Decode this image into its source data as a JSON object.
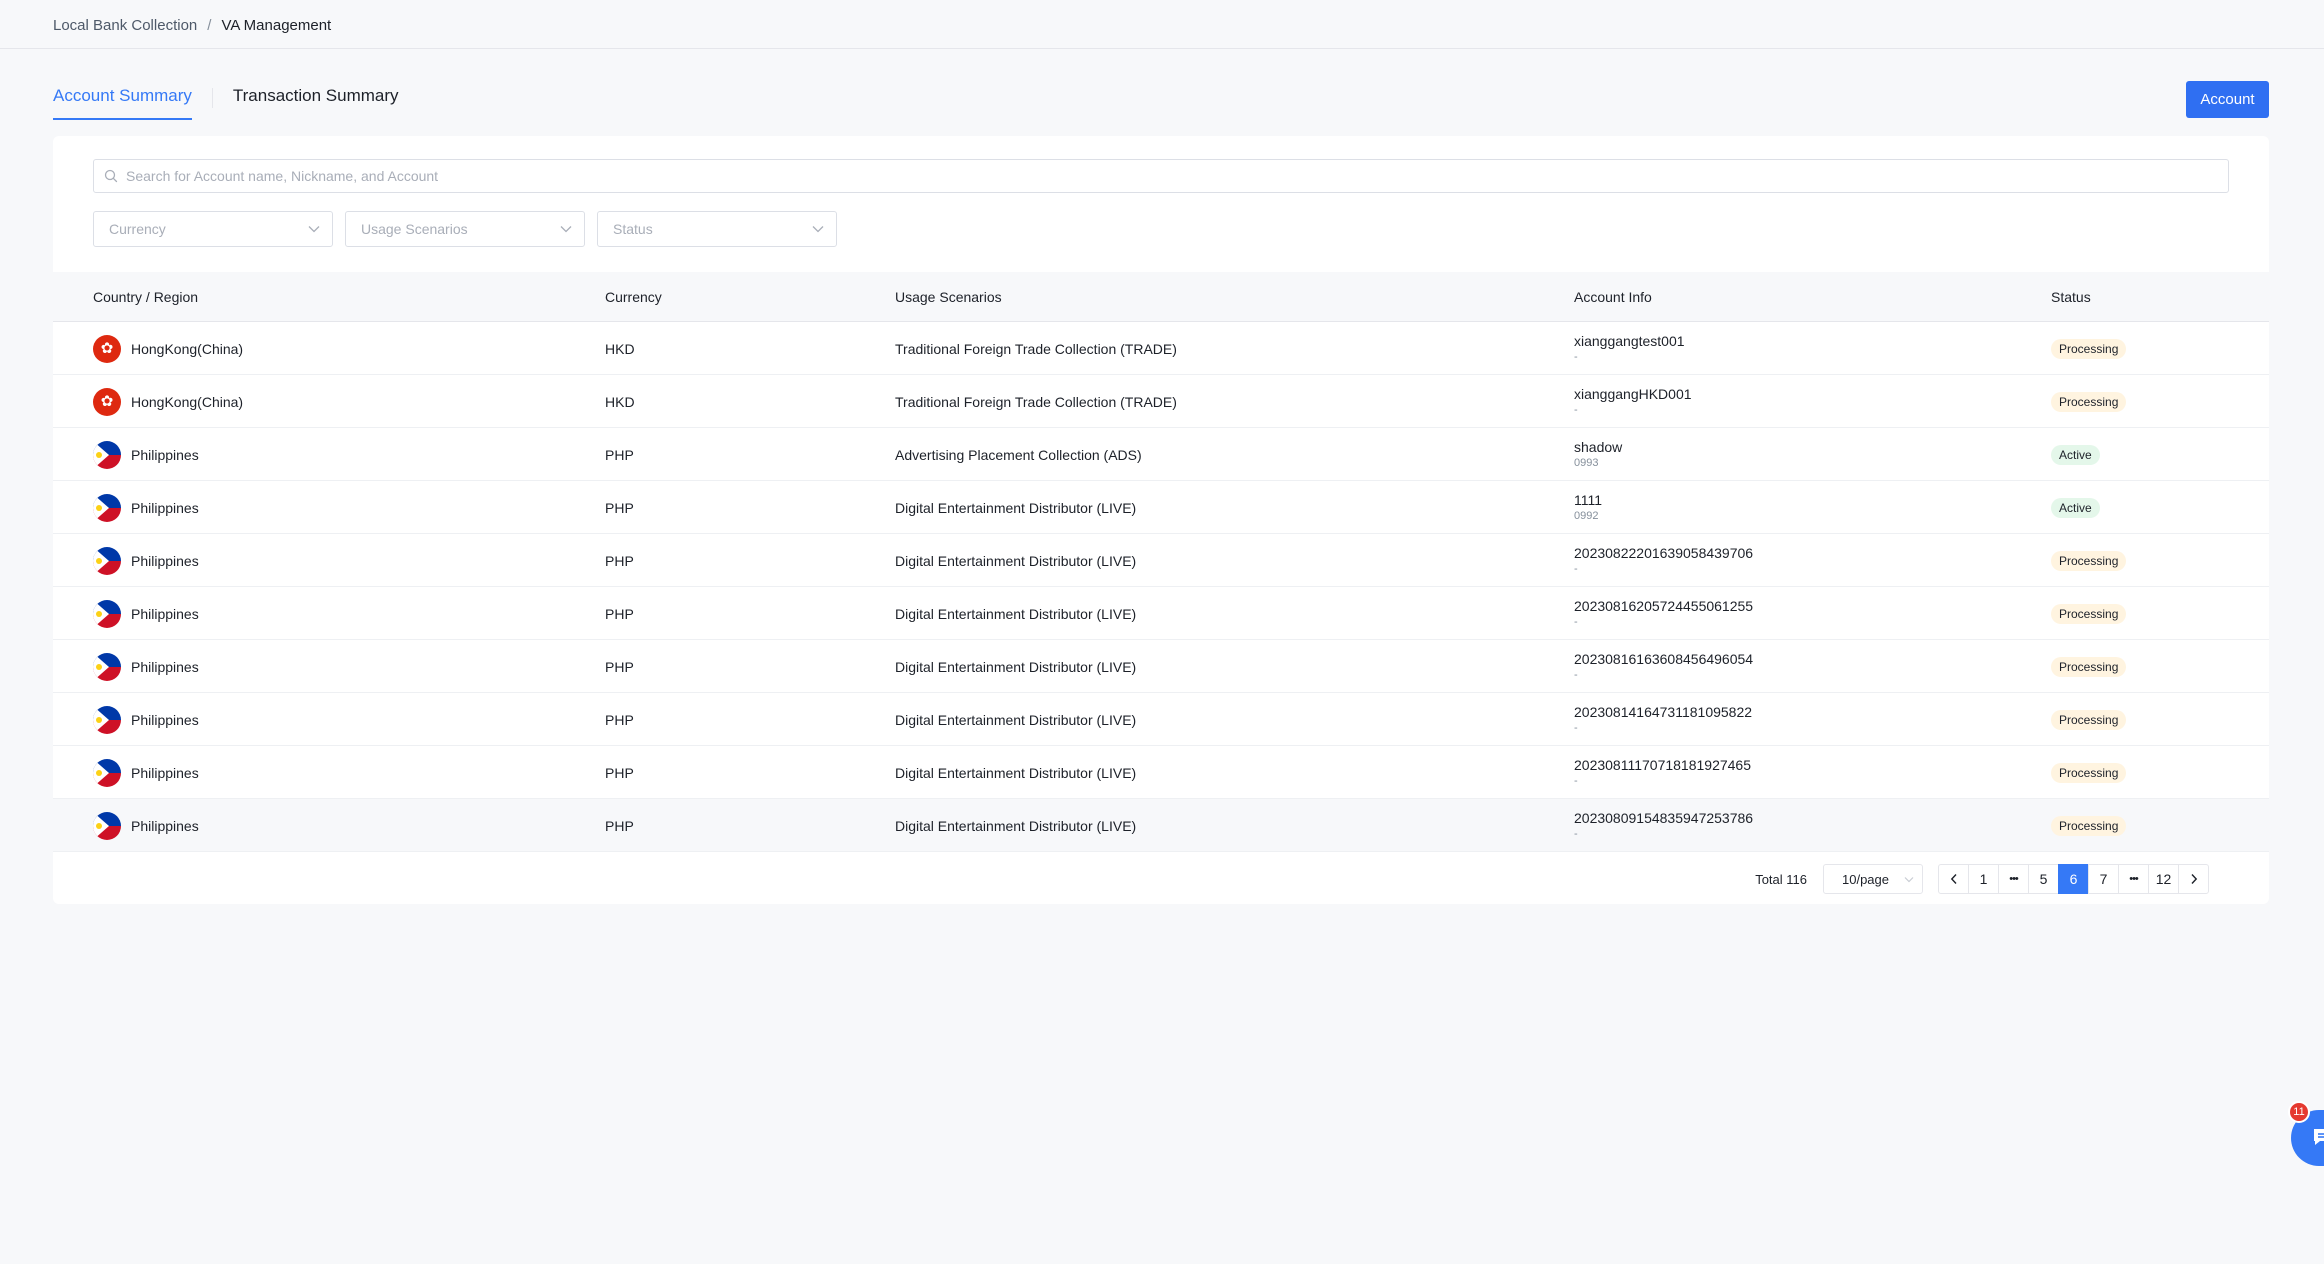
{
  "breadcrumb": {
    "items": [
      "Local Bank Collection",
      "VA Management"
    ],
    "separator": "/"
  },
  "tabs": [
    {
      "label": "Account Summary",
      "active": true
    },
    {
      "label": "Transaction Summary",
      "active": false
    }
  ],
  "account_button": {
    "label": "Account"
  },
  "search": {
    "placeholder": "Search for Account name, Nickname, and Account",
    "value": ""
  },
  "filters": {
    "currency": {
      "placeholder": "Currency"
    },
    "usage_scenarios": {
      "placeholder": "Usage Scenarios"
    },
    "status": {
      "placeholder": "Status"
    }
  },
  "table": {
    "columns": [
      "Country / Region",
      "Currency",
      "Usage Scenarios",
      "Account Info",
      "Status"
    ],
    "rows": [
      {
        "country": "HongKong(China)",
        "flag": "hk",
        "currency": "HKD",
        "usage": "Traditional Foreign Trade Collection (TRADE)",
        "account": "xianggangtest001",
        "account_sub": "-",
        "status": "Processing"
      },
      {
        "country": "HongKong(China)",
        "flag": "hk",
        "currency": "HKD",
        "usage": "Traditional Foreign Trade Collection (TRADE)",
        "account": "xianggangHKD001",
        "account_sub": "-",
        "status": "Processing"
      },
      {
        "country": "Philippines",
        "flag": "ph",
        "currency": "PHP",
        "usage": "Advertising Placement Collection (ADS)",
        "account": "shadow",
        "account_sub": "0993",
        "status": "Active"
      },
      {
        "country": "Philippines",
        "flag": "ph",
        "currency": "PHP",
        "usage": "Digital Entertainment Distributor (LIVE)",
        "account": "1111",
        "account_sub": "0992",
        "status": "Active"
      },
      {
        "country": "Philippines",
        "flag": "ph",
        "currency": "PHP",
        "usage": "Digital Entertainment Distributor (LIVE)",
        "account": "20230822201639058439706",
        "account_sub": "-",
        "status": "Processing"
      },
      {
        "country": "Philippines",
        "flag": "ph",
        "currency": "PHP",
        "usage": "Digital Entertainment Distributor (LIVE)",
        "account": "20230816205724455061255",
        "account_sub": "-",
        "status": "Processing"
      },
      {
        "country": "Philippines",
        "flag": "ph",
        "currency": "PHP",
        "usage": "Digital Entertainment Distributor (LIVE)",
        "account": "20230816163608456496054",
        "account_sub": "-",
        "status": "Processing"
      },
      {
        "country": "Philippines",
        "flag": "ph",
        "currency": "PHP",
        "usage": "Digital Entertainment Distributor (LIVE)",
        "account": "20230814164731181095822",
        "account_sub": "-",
        "status": "Processing"
      },
      {
        "country": "Philippines",
        "flag": "ph",
        "currency": "PHP",
        "usage": "Digital Entertainment Distributor (LIVE)",
        "account": "20230811170718181927465",
        "account_sub": "-",
        "status": "Processing"
      },
      {
        "country": "Philippines",
        "flag": "ph",
        "currency": "PHP",
        "usage": "Digital Entertainment Distributor (LIVE)",
        "account": "20230809154835947253786",
        "account_sub": "-",
        "status": "Processing"
      }
    ]
  },
  "pagination": {
    "total_label": "Total 116",
    "page_size": "10/page",
    "pages": [
      "1",
      "•••",
      "5",
      "6",
      "7",
      "•••",
      "12"
    ],
    "current": "6"
  },
  "chat": {
    "badge": "11"
  },
  "colors": {
    "accent": "#3579f6",
    "processing_bg": "#fff4e0",
    "active_bg": "#e4f7ea",
    "badge_red": "#e5392f"
  }
}
